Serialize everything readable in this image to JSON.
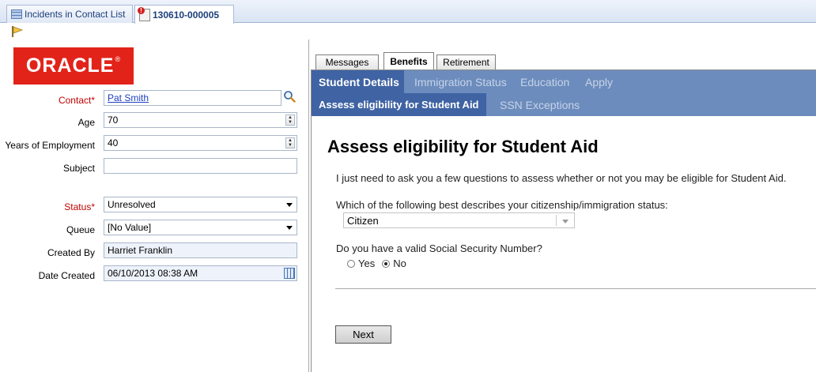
{
  "top_tabs": [
    {
      "label": "Incidents in Contact List",
      "icon": "grid-icon",
      "active": false
    },
    {
      "label": "130610-000005",
      "icon": "incident-icon",
      "active": true
    }
  ],
  "toolbar": {
    "flag_icon": "flag-icon"
  },
  "logo": {
    "text": "ORACLE",
    "reg": "®",
    "color": "#e2231a"
  },
  "form": {
    "contact": {
      "label": "Contact*",
      "value": "Pat Smith"
    },
    "age": {
      "label": "Age",
      "value": "70"
    },
    "years": {
      "label": "Years of Employment",
      "value": "40"
    },
    "subject": {
      "label": "Subject",
      "value": ""
    },
    "status": {
      "label": "Status*",
      "value": "Unresolved"
    },
    "queue": {
      "label": "Queue",
      "value": "[No Value]"
    },
    "created_by": {
      "label": "Created By",
      "value": "Harriet Franklin"
    },
    "date_created": {
      "label": "Date Created",
      "value": "06/10/2013 08:38 AM"
    }
  },
  "sub_tabs": [
    {
      "label": "Messages",
      "active": false
    },
    {
      "label": "Benefits",
      "active": true
    },
    {
      "label": "Retirement",
      "active": false
    }
  ],
  "nav_row1": [
    {
      "label": "Student Details",
      "active": true
    },
    {
      "label": "Immigration Status",
      "active": false
    },
    {
      "label": "Education",
      "active": false
    },
    {
      "label": "Apply",
      "active": false
    }
  ],
  "nav_row2": [
    {
      "label": "Assess eligibility for Student Aid",
      "active": true
    },
    {
      "label": "SSN Exceptions",
      "active": false
    }
  ],
  "content": {
    "title": "Assess eligibility for Student Aid",
    "intro": "I just need to ask you a few questions to assess whether or not you may be eligible for Student Aid.",
    "q1": "Which of the following best describes your citizenship/immigration status:",
    "citizenship_value": "Citizen",
    "q2": "Do you have a valid Social Security Number?",
    "ssn_yes": "Yes",
    "ssn_no": "No",
    "ssn_selected": "No",
    "next_label": "Next"
  },
  "colors": {
    "nav_bg": "#6c8cbd",
    "nav_active": "#3f63a3",
    "required_label": "#c00000",
    "link": "#1f3fbf"
  }
}
